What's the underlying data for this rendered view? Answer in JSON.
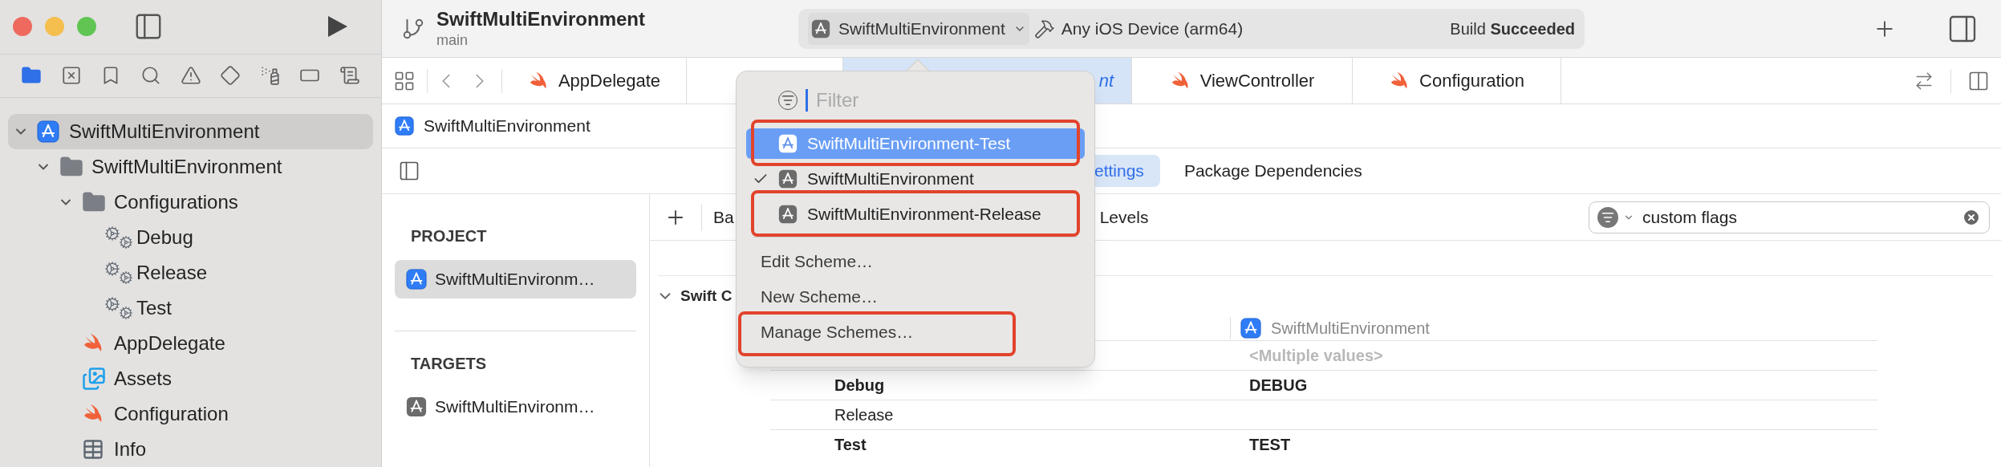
{
  "toolbar": {
    "title": "SwiftMultiEnvironment",
    "branch": "main",
    "scheme": "SwiftMultiEnvironment",
    "destination": "Any iOS Device (arm64)",
    "status": "Build **Succeeded**"
  },
  "navigator_tabs": [
    {
      "kind": "project",
      "selected": true
    },
    {
      "kind": "source_control",
      "selected": false
    },
    {
      "kind": "bookmarks",
      "selected": false
    },
    {
      "kind": "find",
      "selected": false
    },
    {
      "kind": "issues",
      "selected": false
    },
    {
      "kind": "tests",
      "selected": false
    },
    {
      "kind": "debug",
      "selected": false
    },
    {
      "kind": "breakpoints",
      "selected": false
    },
    {
      "kind": "reports",
      "selected": false
    }
  ],
  "project_tree": [
    {
      "label": "SwiftMultiEnvironment",
      "kind": "project",
      "expanded": true,
      "selected": true,
      "children": [
        {
          "label": "SwiftMultiEnvironment",
          "kind": "folder",
          "expanded": true,
          "selected": false,
          "children": [
            {
              "label": "Configurations",
              "kind": "folder",
              "expanded": true,
              "selected": false,
              "children": [
                {
                  "label": "Debug",
                  "kind": "config",
                  "selected": false
                },
                {
                  "label": "Release",
                  "kind": "config",
                  "selected": false
                },
                {
                  "label": "Test",
                  "kind": "config",
                  "selected": false
                }
              ]
            },
            {
              "label": "AppDelegate",
              "kind": "swift",
              "selected": false
            },
            {
              "label": "Assets",
              "kind": "assets",
              "selected": false
            },
            {
              "label": "Configuration",
              "kind": "swift",
              "selected": false
            },
            {
              "label": "Info",
              "kind": "plist",
              "selected": false
            }
          ]
        }
      ]
    }
  ],
  "editor_tabs": [
    {
      "label": "AppDelegate",
      "kind": "swift",
      "selected": false,
      "preview": false
    },
    {
      "label": "nt",
      "selected": true,
      "preview": true
    },
    {
      "label": "ViewController",
      "kind": "swift",
      "selected": false,
      "preview": false
    },
    {
      "label": "Configuration",
      "kind": "swift",
      "selected": false,
      "preview": false
    }
  ],
  "breadcrumb": "SwiftMultiEnvironment",
  "editor_segments": [
    {
      "label": "ettings",
      "selected": true
    },
    {
      "label": "Package Dependencies",
      "selected": false
    }
  ],
  "project_list": [
    {
      "heading": "PROJECT",
      "items": [
        {
          "label": "SwiftMultiEnvironm…",
          "kind": "project",
          "selected": true
        }
      ]
    },
    {
      "heading": "TARGETS",
      "items": [
        {
          "label": "SwiftMultiEnvironm…",
          "kind": "app",
          "selected": false
        }
      ]
    }
  ],
  "settings": {
    "filters": [
      "Ba",
      "Levels"
    ],
    "search": {
      "value": "custom flags"
    },
    "section": {
      "title": "Swift C",
      "expanded": true
    },
    "column_header": "SwiftMultiEnvironment",
    "rows": [
      {
        "kind": "setting",
        "value": "<Multiple values>",
        "bold": true
      },
      {
        "kind": "config",
        "label": "Debug",
        "value": "DEBUG",
        "bold": true
      },
      {
        "kind": "config",
        "label": "Release",
        "bold": false
      },
      {
        "kind": "config",
        "label": "Test",
        "value": "TEST",
        "bold": true
      }
    ]
  },
  "scheme_menu": {
    "placeholder": "Filter",
    "schemes": [
      {
        "label": "SwiftMultiEnvironment-Test",
        "selected": true,
        "checked": false,
        "annotated": true
      },
      {
        "label": "SwiftMultiEnvironment",
        "selected": false,
        "checked": true,
        "annotated": false
      },
      {
        "label": "SwiftMultiEnvironment-Release",
        "selected": false,
        "checked": false,
        "annotated": true
      }
    ],
    "actions": [
      {
        "label": "Edit Scheme…",
        "annotated": false
      },
      {
        "label": "New Scheme…",
        "annotated": false
      },
      {
        "label": "Manage Schemes…",
        "annotated": true
      }
    ]
  }
}
